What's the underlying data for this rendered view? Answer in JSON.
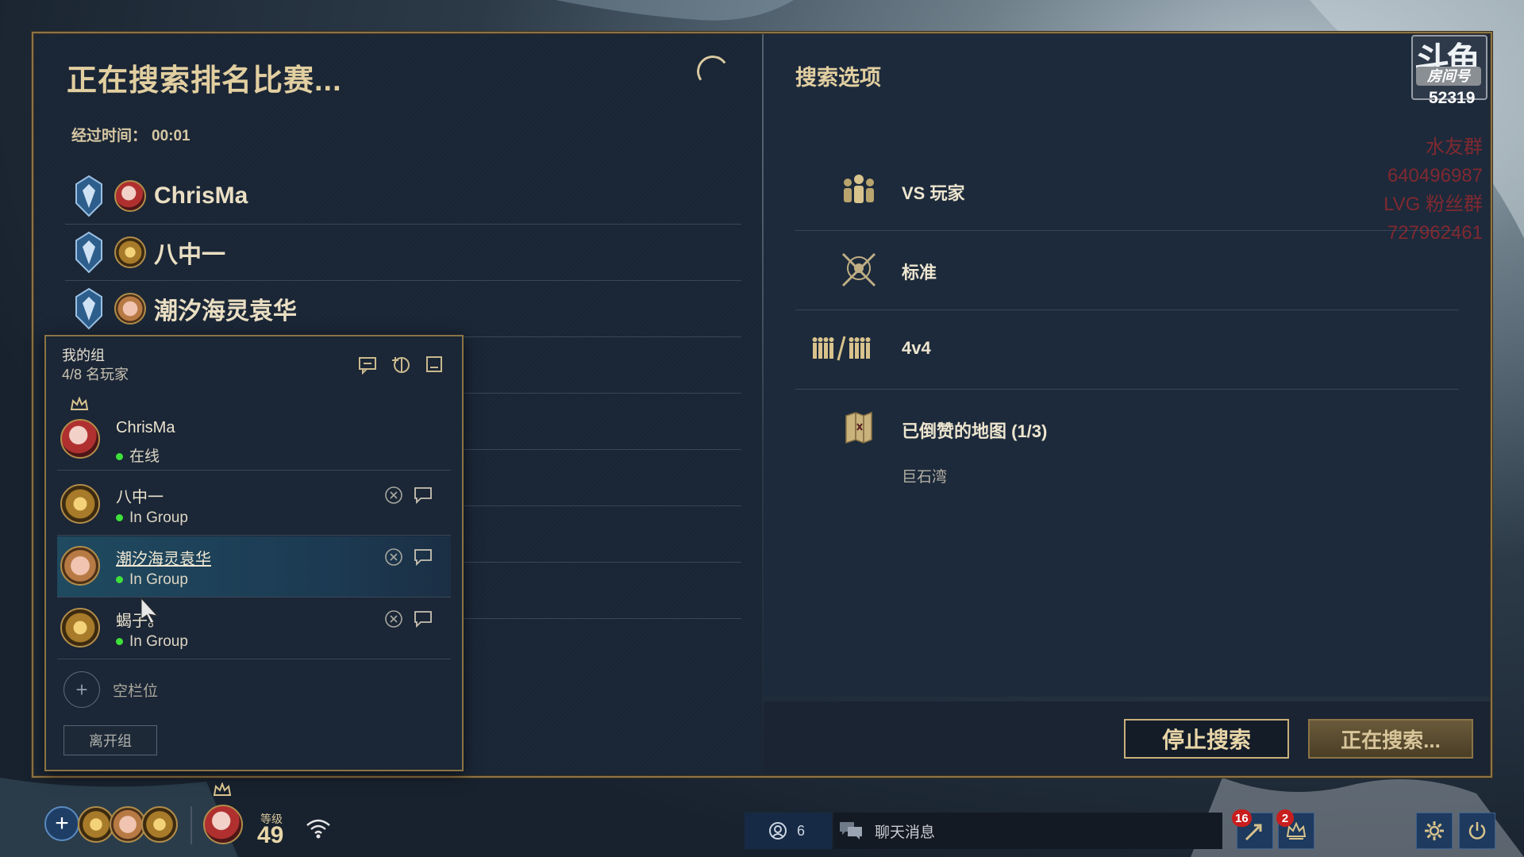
{
  "search": {
    "title": "正在搜索排名比赛...",
    "elapsed_label": "经过时间：",
    "elapsed_value": "00:01"
  },
  "queue_players": [
    {
      "name": "ChrisMa",
      "avatar": "red-hooded-avatar"
    },
    {
      "name": "八中一",
      "avatar": "gold-emblem-avatar"
    },
    {
      "name": "潮汐海灵袁华",
      "avatar": "pig-avatar"
    }
  ],
  "group": {
    "title": "我的组",
    "subtitle": "4/8 名玩家",
    "members": [
      {
        "name": "ChrisMa",
        "status": "在线",
        "leader": true
      },
      {
        "name": "八中一",
        "status": "In Group"
      },
      {
        "name": "潮汐海灵袁华",
        "status": "In Group",
        "highlighted": true
      },
      {
        "name": "蝎子。",
        "status": "In Group"
      }
    ],
    "empty_slot_label": "空栏位",
    "leave_label": "离开组"
  },
  "options": {
    "title": "搜索选项",
    "items": [
      {
        "label": "VS 玩家",
        "icon": "players-icon"
      },
      {
        "label": "标准",
        "icon": "crossed-swords-icon"
      },
      {
        "label": "4v4",
        "icon": "team-size-icon"
      },
      {
        "label": "已倒赞的地图 (1/3)",
        "icon": "map-icon",
        "sub": "巨石湾"
      }
    ]
  },
  "buttons": {
    "stop": "停止搜索",
    "searching": "正在搜索..."
  },
  "room": {
    "badge": "房间号",
    "number": "52319"
  },
  "overlay_lines": [
    "水友群",
    "640496987",
    "LVG 粉丝群",
    "727962461"
  ],
  "bottom_bar": {
    "level_label": "等级",
    "level": "49",
    "friends_count": "6",
    "chat_label": "聊天消息",
    "notif_count_1": "16",
    "notif_count_2": "2"
  },
  "colors": {
    "accent_gold": "#e2cfa0",
    "frame_gold": "#8c7445",
    "online_green": "#3ee03a",
    "panel": "#1d2a3b"
  }
}
